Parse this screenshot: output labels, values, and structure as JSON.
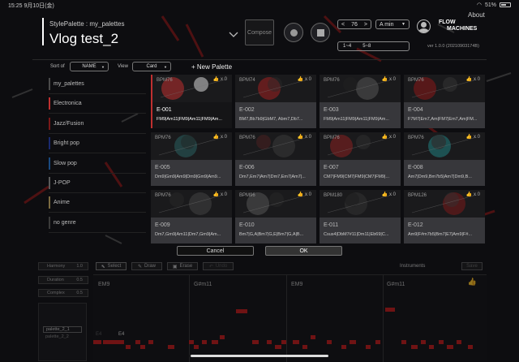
{
  "status": {
    "time": "15:25",
    "date": "9月10日(金)",
    "battery": "51%"
  },
  "header": {
    "subtitle": "StylePalette : my_palettes",
    "title": "Vlog test_2",
    "compose_label": "Compose",
    "tempo": "76",
    "key": "A min",
    "range": {
      "left": "1~4",
      "right": "5~8"
    },
    "about": "About",
    "logo_line1": "FLOW",
    "logo_line2": "MACHINES",
    "version": "ver 1.0.0 (20210903174B)"
  },
  "toolbar": {
    "sort_label": "Sort of",
    "sort_value": "NAME",
    "view_label": "View",
    "view_value": "Card",
    "new_palette": "+ New Palette"
  },
  "sidebar": {
    "items": [
      {
        "label": "my_palettes",
        "color": "#4a4a4a"
      },
      {
        "label": "Electronica",
        "color": "#c03030"
      },
      {
        "label": "Jazz/Fusion",
        "color": "#7a1818"
      },
      {
        "label": "Bright pop",
        "color": "#1a2a70"
      },
      {
        "label": "Slow pop",
        "color": "#1a4a80"
      },
      {
        "label": "J-POP",
        "color": "#5a5a5a"
      },
      {
        "label": "Anime",
        "color": "#7a6a40"
      },
      {
        "label": "no genre",
        "color": "#3a3a3a"
      }
    ]
  },
  "cards": [
    {
      "bpm": "BPM76",
      "likes": "x 0",
      "code": "E-001",
      "chords": "FM9|Am11|FM9|Am11|FM9|Am...",
      "selected": true
    },
    {
      "bpm": "BPM74",
      "likes": "x 0",
      "code": "E-002",
      "chords": "BM7,Bb7b9|GbM7, Abm7,Db7...",
      "selected": false
    },
    {
      "bpm": "BPM76",
      "likes": "x 0",
      "code": "E-003",
      "chords": "FM9|Am11|FM9|Am11|FM9|Am...",
      "selected": false
    },
    {
      "bpm": "BPM76",
      "likes": "x 0",
      "code": "E-004",
      "chords": "F7M7|Em7,Am|FM7|Em7,Am|FM...",
      "selected": false
    },
    {
      "bpm": "BPM76",
      "likes": "x 0",
      "code": "E-005",
      "chords": "Dm9|Gm9|Am9|Dm9|Gm9|Am9...",
      "selected": false
    },
    {
      "bpm": "BPM76",
      "likes": "x 0",
      "code": "E-006",
      "chords": "Dm7,Em7|Am7|Dm7,Em7|Am7|...",
      "selected": false
    },
    {
      "bpm": "BPM76",
      "likes": "x 0",
      "code": "E-007",
      "chords": "CM7|FM9|CM7|FM9|CM7|FM9|...",
      "selected": false
    },
    {
      "bpm": "BPM76",
      "likes": "x 0",
      "code": "E-008",
      "chords": "Am7|Dm9,Bm7b5|Am7|Dm9,B...",
      "selected": false
    },
    {
      "bpm": "BPM76",
      "likes": "x 0",
      "code": "E-009",
      "chords": "Dm7,Gm9|Am11|Dm7,Gm9|Am...",
      "selected": false
    },
    {
      "bpm": "BPM96",
      "likes": "x 0",
      "code": "E-010",
      "chords": "Bm7|G,A|Bm7|G,E|Bm7|G,A|B...",
      "selected": false
    },
    {
      "bpm": "BPM180",
      "likes": "x 0",
      "code": "E-011",
      "chords": "Csus4|DbM7#11|Dm11|Eb69|C...",
      "selected": false
    },
    {
      "bpm": "BPM126",
      "likes": "x 0",
      "code": "E-012",
      "chords": "Am9|F#m7b5|Bm7|E7|Am9|F#...",
      "selected": false
    }
  ],
  "actions": {
    "cancel": "Cancel",
    "ok": "OK"
  },
  "lower": {
    "harmony_label": "Harmony",
    "harmony_value": "1.0",
    "duration_label": "Duration",
    "duration_value": "0.5",
    "complex_label": "Complex",
    "complex_value": "0.5",
    "select": "Select",
    "draw": "Draw",
    "erase": "Erase",
    "undo": "Undo",
    "instruments": "Instruments",
    "save": "Save",
    "palette_items": [
      "palette_2_1",
      "palette_2_2"
    ],
    "note_label": "E4",
    "chords": [
      "EM9",
      "G#m11",
      "EM9",
      "G#m11"
    ]
  }
}
